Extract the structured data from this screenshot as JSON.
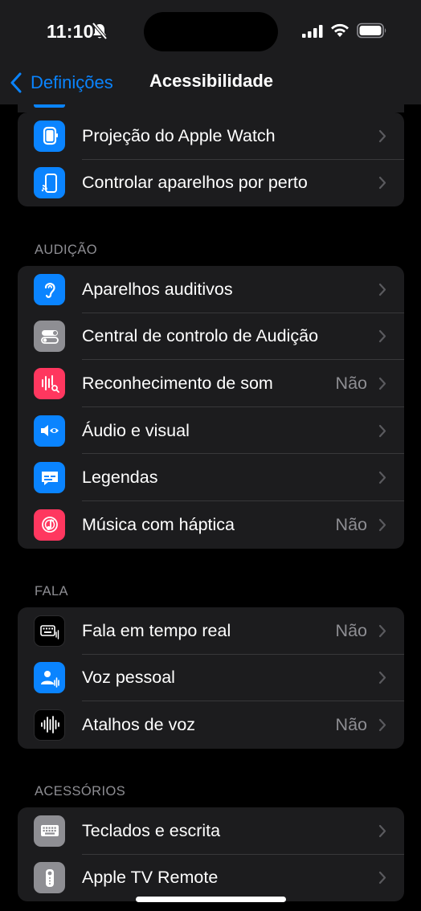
{
  "status": {
    "time": "11:10"
  },
  "nav": {
    "back_label": "Definições",
    "title": "Acessibilidade"
  },
  "group_top": [
    {
      "label": "Projeção do Apple Watch",
      "value": "",
      "icon": "apple-watch-mirroring-icon",
      "color": "#0a84ff"
    },
    {
      "label": "Controlar aparelhos por perto",
      "value": "",
      "icon": "nearby-devices-icon",
      "color": "#0a84ff"
    }
  ],
  "sections": {
    "audicao": {
      "header": "AUDIÇÃO",
      "items": [
        {
          "label": "Aparelhos auditivos",
          "value": "",
          "icon": "ear-icon",
          "color": "#0a84ff"
        },
        {
          "label": "Central de controlo de Audição",
          "value": "",
          "icon": "toggles-icon",
          "color": "#8e8e93"
        },
        {
          "label": "Reconhecimento de som",
          "value": "Não",
          "icon": "sound-wave-search-icon",
          "color": "#ff375f"
        },
        {
          "label": "Áudio e visual",
          "value": "",
          "icon": "speaker-eye-icon",
          "color": "#0a84ff"
        },
        {
          "label": "Legendas",
          "value": "",
          "icon": "caption-bubble-icon",
          "color": "#0a84ff"
        },
        {
          "label": "Música com háptica",
          "value": "Não",
          "icon": "music-haptic-icon",
          "color": "#ff375f"
        }
      ]
    },
    "fala": {
      "header": "FALA",
      "items": [
        {
          "label": "Fala em tempo real",
          "value": "Não",
          "icon": "keyboard-wave-icon",
          "color": "#000000"
        },
        {
          "label": "Voz pessoal",
          "value": "",
          "icon": "person-wave-icon",
          "color": "#0a84ff"
        },
        {
          "label": "Atalhos de voz",
          "value": "Não",
          "icon": "waveform-icon",
          "color": "#000000"
        }
      ]
    },
    "acessorios": {
      "header": "ACESSÓRIOS",
      "items": [
        {
          "label": "Teclados e escrita",
          "value": "",
          "icon": "keyboard-icon",
          "color": "#8e8e93"
        },
        {
          "label": "Apple TV Remote",
          "value": "",
          "icon": "tv-remote-icon",
          "color": "#8e8e93"
        }
      ]
    }
  }
}
